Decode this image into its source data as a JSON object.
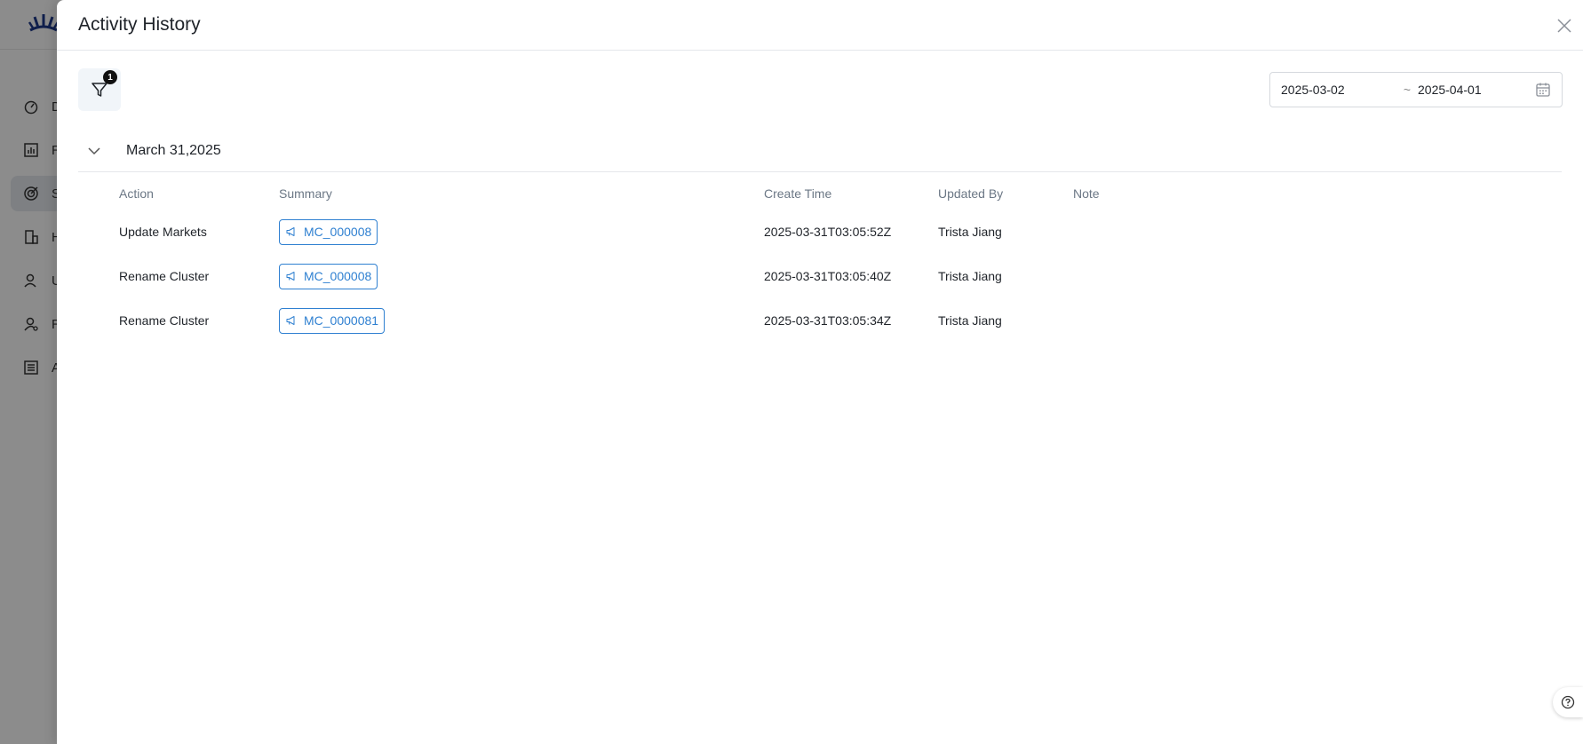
{
  "background_app": {
    "nav_items": [
      {
        "label": "D",
        "icon": "gauge-icon"
      },
      {
        "label": "R",
        "icon": "bar-chart-icon"
      },
      {
        "label": "S",
        "icon": "target-icon"
      },
      {
        "label": "H",
        "icon": "building-icon"
      },
      {
        "label": "U",
        "icon": "user-icon"
      },
      {
        "label": "R",
        "icon": "user-settings-icon"
      },
      {
        "label": "A",
        "icon": "list-icon"
      }
    ]
  },
  "drawer": {
    "title": "Activity History",
    "filter_badge_count": "1",
    "date_range": {
      "start": "2025-03-02",
      "separator": "~",
      "end": "2025-04-01"
    },
    "group": {
      "title": "March 31,2025"
    },
    "columns": {
      "action": "Action",
      "summary": "Summary",
      "create_time": "Create Time",
      "updated_by": "Updated By",
      "note": "Note"
    },
    "rows": [
      {
        "action": "Update Markets",
        "summary_tag": "MC_000008",
        "create_time": "2025-03-31T03:05:52Z",
        "updated_by": "Trista Jiang",
        "note": ""
      },
      {
        "action": "Rename Cluster",
        "summary_tag": "MC_000008",
        "create_time": "2025-03-31T03:05:40Z",
        "updated_by": "Trista Jiang",
        "note": ""
      },
      {
        "action": "Rename Cluster",
        "summary_tag": "MC_0000081",
        "create_time": "2025-03-31T03:05:34Z",
        "updated_by": "Trista Jiang",
        "note": ""
      }
    ]
  },
  "colors": {
    "accent": "#2f80d1",
    "overlay": "rgba(0,0,0,0.45)",
    "header_text": "#6b7785"
  }
}
